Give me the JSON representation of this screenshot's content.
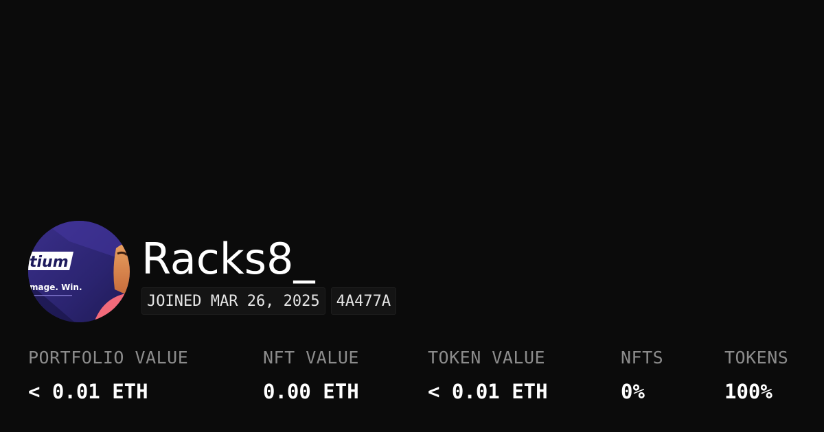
{
  "profile": {
    "username": "Racks8_",
    "joined": "JOINED MAR 26, 2025",
    "id_badge": "4A477A",
    "avatar": {
      "icon": "avatar-image",
      "text_top": "tium",
      "text_bottom": "mage. Win."
    }
  },
  "stats": [
    {
      "label": "PORTFOLIO VALUE",
      "value": "< 0.01 ETH"
    },
    {
      "label": "NFT VALUE",
      "value": "0.00 ETH"
    },
    {
      "label": "TOKEN VALUE",
      "value": "< 0.01 ETH"
    },
    {
      "label": "NFTS",
      "value": "0%"
    },
    {
      "label": "TOKENS",
      "value": "100%"
    }
  ],
  "colors": {
    "background": "#0b0b0b",
    "label": "#8c8c8c",
    "value": "#ffffff",
    "badge_bg": "#141414"
  }
}
